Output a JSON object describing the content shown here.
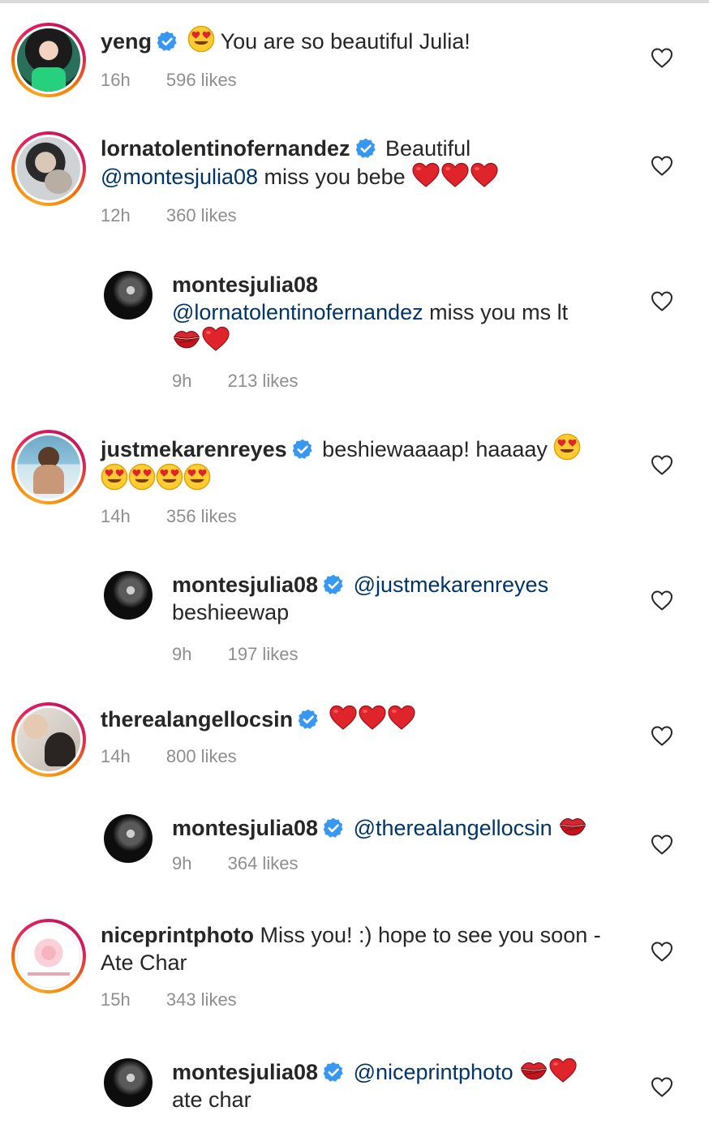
{
  "comments": [
    {
      "username": "yeng",
      "verified": true,
      "text_before": "",
      "text": "You are so beautiful Julia!",
      "time": "16h",
      "likes": "596 likes"
    },
    {
      "username": "lornatolentinofernandez",
      "verified": true,
      "text": "Beautiful",
      "mention": "@montesjulia08",
      "text_after": "miss you bebe",
      "time": "12h",
      "likes": "360 likes"
    },
    {
      "username": "montesjulia08",
      "verified": false,
      "mention": "@lornatolentinofernandez",
      "text_after": "miss you ms lt",
      "time": "9h",
      "likes": "213 likes"
    },
    {
      "username": "justmekarenreyes",
      "verified": true,
      "text": "beshiewaaaap! haaaay",
      "time": "14h",
      "likes": "356 likes"
    },
    {
      "username": "montesjulia08",
      "verified": true,
      "mention": "@justmekarenreyes",
      "text_after": "beshieewap",
      "time": "9h",
      "likes": "197 likes"
    },
    {
      "username": "therealangellocsin",
      "verified": true,
      "time": "14h",
      "likes": "800 likes"
    },
    {
      "username": "montesjulia08",
      "verified": true,
      "mention": "@therealangellocsin",
      "time": "9h",
      "likes": "364 likes"
    },
    {
      "username": "niceprintphoto",
      "verified": false,
      "text": "Miss you! :) hope to see you soon - Ate Char",
      "time": "15h",
      "likes": "343 likes"
    },
    {
      "username": "montesjulia08",
      "verified": true,
      "mention": "@niceprintphoto",
      "text_after": "ate char"
    }
  ],
  "icons": {
    "verified": "verified-badge-icon",
    "like": "heart-outline-icon",
    "heart_emoji": "red-heart-emoji",
    "heart_eyes": "heart-eyes-emoji",
    "kiss": "kiss-mark-emoji"
  },
  "colors": {
    "verified": "#3897f0",
    "mention": "#003569",
    "meta": "#8e8e8e",
    "heart": "#e0242b"
  }
}
